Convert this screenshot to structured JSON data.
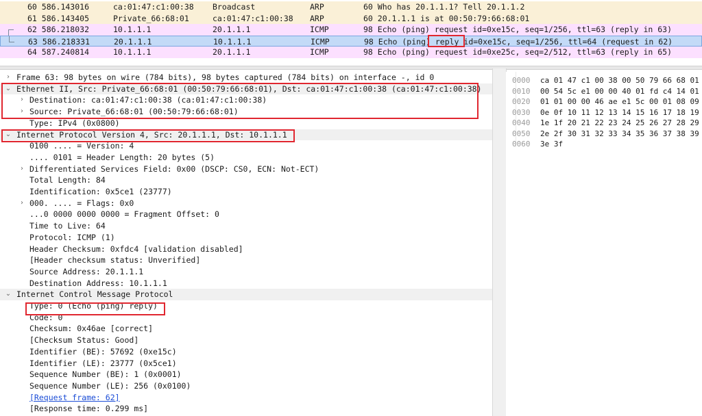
{
  "packets": [
    {
      "no_time": "60 586.143016",
      "src": "ca:01:47:c1:00:38",
      "dst": "Broadcast",
      "proto": "ARP",
      "info": "60 Who has 20.1.1.1? Tell 20.1.1.2",
      "bg": "#faf0d7"
    },
    {
      "no_time": "61 586.143405",
      "src": "Private_66:68:01",
      "dst": "ca:01:47:c1:00:38",
      "proto": "ARP",
      "info": "60 20.1.1.1 is at 00:50:79:66:68:01",
      "bg": "#faf0d7"
    },
    {
      "no_time": "62 586.218032",
      "src": "10.1.1.1",
      "dst": "20.1.1.1",
      "proto": "ICMP",
      "info": "98 Echo (ping) request  id=0xe15c, seq=1/256, ttl=63 (reply in 63)",
      "bg": "#fce0ff"
    },
    {
      "no_time": "63 586.218331",
      "src": "20.1.1.1",
      "dst": "10.1.1.1",
      "proto": "ICMP",
      "info_parts": [
        "98 Echo (ping) ",
        "reply",
        "  id=0xe15c, seq=1/256, ttl=64 (request in 62)"
      ],
      "bg": "#c3daf7"
    },
    {
      "no_time": "64 587.240814",
      "src": "10.1.1.1",
      "dst": "20.1.1.1",
      "proto": "ICMP",
      "info": "98 Echo (ping) request  id=0xe25c, seq=2/512, ttl=63 (reply in 65)",
      "bg": "#fce0ff"
    }
  ],
  "details": [
    {
      "text": "Frame 63: 98 bytes on wire (784 bits), 98 bytes captured (784 bits) on interface -, id 0",
      "arrow": "›"
    },
    {
      "text": "Ethernet II, Src: Private_66:68:01 (00:50:79:66:68:01), Dst: ca:01:47:c1:00:38 (ca:01:47:c1:00:38)",
      "arrow": "⌄"
    },
    {
      "text": "Destination: ca:01:47:c1:00:38 (ca:01:47:c1:00:38)",
      "arrow": "›"
    },
    {
      "text": "Source: Private_66:68:01 (00:50:79:66:68:01)",
      "arrow": "›"
    },
    {
      "text": "Type: IPv4 (0x0800)"
    },
    {
      "text": "Internet Protocol Version 4, Src: 20.1.1.1, Dst: 10.1.1.1",
      "arrow": "⌄"
    },
    {
      "text": "0100 .... = Version: 4"
    },
    {
      "text": ".... 0101 = Header Length: 20 bytes (5)"
    },
    {
      "text": "Differentiated Services Field: 0x00 (DSCP: CS0, ECN: Not-ECT)",
      "arrow": "›"
    },
    {
      "text": "Total Length: 84"
    },
    {
      "text": "Identification: 0x5ce1 (23777)"
    },
    {
      "text": "000. .... = Flags: 0x0",
      "arrow": "›"
    },
    {
      "text": "...0 0000 0000 0000 = Fragment Offset: 0"
    },
    {
      "text": "Time to Live: 64"
    },
    {
      "text": "Protocol: ICMP (1)"
    },
    {
      "text": "Header Checksum: 0xfdc4 [validation disabled]"
    },
    {
      "text": "[Header checksum status: Unverified]"
    },
    {
      "text": "Source Address: 20.1.1.1"
    },
    {
      "text": "Destination Address: 10.1.1.1"
    },
    {
      "text": "Internet Control Message Protocol",
      "arrow": "⌄"
    },
    {
      "text": "Type: 0 (Echo (ping) reply)"
    },
    {
      "text": "Code: 0"
    },
    {
      "text": "Checksum: 0x46ae [correct]"
    },
    {
      "text": "[Checksum Status: Good]"
    },
    {
      "text": "Identifier (BE): 57692 (0xe15c)"
    },
    {
      "text": "Identifier (LE): 23777 (0x5ce1)"
    },
    {
      "text": "Sequence Number (BE): 1 (0x0001)"
    },
    {
      "text": "Sequence Number (LE): 256 (0x0100)"
    },
    {
      "text": "[Request frame: 62]"
    },
    {
      "text": "[Response time: 0.299 ms]"
    }
  ],
  "hex": [
    {
      "offset": "0000",
      "bytes": "ca 01 47 c1 00 38 00 50  79 66 68 01"
    },
    {
      "offset": "0010",
      "bytes": "00 54 5c e1 00 00 40 01  fd c4 14 01"
    },
    {
      "offset": "0020",
      "bytes": "01 01 00 00 46 ae e1 5c  00 01 08 09"
    },
    {
      "offset": "0030",
      "bytes": "0e 0f 10 11 12 13 14 15  16 17 18 19"
    },
    {
      "offset": "0040",
      "bytes": "1e 1f 20 21 22 23 24 25  26 27 28 29"
    },
    {
      "offset": "0050",
      "bytes": "2e 2f 30 31 32 33 34 35  36 37 38 39"
    },
    {
      "offset": "0060",
      "bytes": "3e 3f"
    }
  ],
  "colors": {
    "selected_row": "#c3daf7",
    "icmp_row": "#fce0ff",
    "arp_row": "#faf0d7",
    "annotation_red": "#e0262f",
    "link": "#1a4cd6"
  }
}
